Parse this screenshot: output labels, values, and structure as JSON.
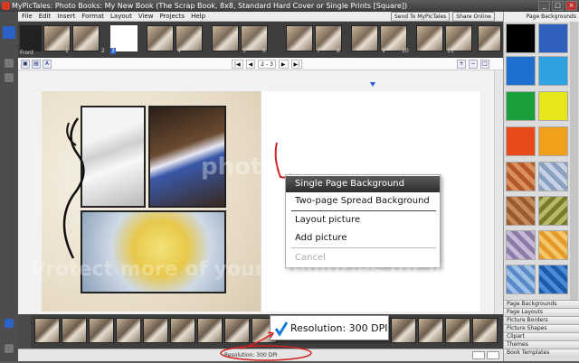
{
  "window": {
    "title": "MyPicTales: Photo Books: My New Book (The Scrap Book, 8x8, Standard Hard Cover or Single Prints [Square])",
    "buttons": [
      "_",
      "□",
      "×"
    ]
  },
  "menu": [
    "File",
    "Edit",
    "Insert",
    "Format",
    "Layout",
    "View",
    "Projects",
    "Help"
  ],
  "top_buttons": {
    "send": "Send To MyPicTales",
    "share": "Share Online"
  },
  "strip": {
    "front_label": "Front",
    "page_numbers": [
      "1",
      "2",
      "3",
      "4",
      "5",
      "6",
      "7",
      "8",
      "9",
      "10",
      "11"
    ],
    "selected_page": "3"
  },
  "toolbar": {
    "page_range": "2 - 3"
  },
  "context_menu": {
    "items": [
      {
        "label": "Single Page Background",
        "state": "highlighted"
      },
      {
        "label": "Two-page Spread Background",
        "state": "normal"
      },
      {
        "label": "Layout picture",
        "state": "normal"
      },
      {
        "label": "Add picture",
        "state": "normal"
      },
      {
        "label": "Cancel",
        "state": "disabled"
      }
    ]
  },
  "right_panel": {
    "title": "Page Backgrounds",
    "swatch_colors": [
      "#000000",
      "#2f5fbf",
      "#1f6fcf",
      "#2fa0e0",
      "#1aa03a",
      "#e6e61a",
      "#e84a1a",
      "#f0a01a"
    ],
    "tabs": [
      "Page Backgrounds",
      "Page Layouts",
      "Picture Borders",
      "Picture Shapes",
      "Clipart",
      "Themes",
      "Book Templates"
    ]
  },
  "resolution_popup": {
    "text": "Resolution: 300 DPI"
  },
  "status_bar": {
    "resolution_text": "Resolution: 300 DPI"
  },
  "colors": {
    "accent": "#2a5bd7",
    "highlight_menu": "#3a3a3a",
    "annotation_red": "#d42020"
  },
  "watermarks": {
    "top": "photobucket",
    "bottom": "Protect more of your memories for less!"
  }
}
